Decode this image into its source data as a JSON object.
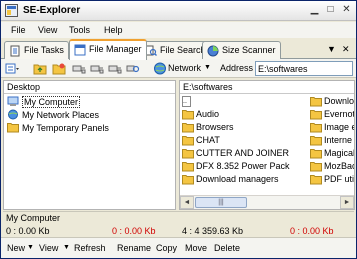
{
  "window": {
    "title": "SE-Explorer"
  },
  "menu": [
    "File",
    "View",
    "Tools",
    "Help"
  ],
  "tabs": [
    {
      "label": "File Tasks",
      "icon": "file-tasks-icon"
    },
    {
      "label": "File Manager",
      "icon": "file-manager-icon",
      "active": true
    },
    {
      "label": "File Search",
      "icon": "file-search-icon"
    },
    {
      "label": "Size Scanner",
      "icon": "size-scanner-icon"
    }
  ],
  "tab_controls": {
    "dropdown": "▼",
    "close": "✕"
  },
  "toolbar": {
    "network_label": "Network",
    "address_label": "Address",
    "address_value": "E:\\softwares"
  },
  "left_pane": {
    "header": "Desktop",
    "items": [
      "My Computer",
      "My Network Places",
      "My Temporary Panels"
    ],
    "status_name": "My Computer",
    "status_left": "0 : 0.00 Kb",
    "status_right": "0 : 0.00 Kb"
  },
  "right_pane": {
    "header": "E:\\softwares",
    "col1": [
      "..",
      "Audio",
      "Browsers",
      "CHAT",
      "CUTTER AND JOINER",
      "DFX 8.352 Power Pack",
      "Download managers"
    ],
    "col2": [
      "Downlo",
      "Evernot",
      "Image e",
      "Interne",
      "Magical",
      "MozBac",
      "PDF util"
    ],
    "status_left": "4 : 4 359.63 Kb",
    "status_right": "0 : 0.00 Kb"
  },
  "bottombar": [
    "New",
    "View",
    "Refresh",
    "Rename",
    "Copy",
    "Move",
    "Delete"
  ],
  "colors": {
    "accent": "#f0a030",
    "red_value": "#d00000",
    "folder": "#f4c542"
  }
}
